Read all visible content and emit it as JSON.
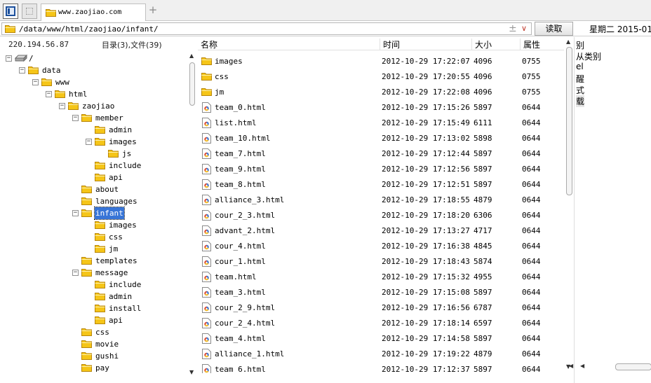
{
  "tabbar": {
    "tab_title": "www.zaojiao.com",
    "add_tab_symbol": "+"
  },
  "address": {
    "path": "/data/www/html/zaojiao/infant/",
    "add_symbol": "±",
    "dropdown_symbol": "∨",
    "read_button": "读取",
    "date": "星期二 2015-01-"
  },
  "tree_panel": {
    "host": "220.194.56.87",
    "summary": "目录(3),文件(39)",
    "nodes": [
      {
        "label": "/",
        "exp": "−",
        "icon": "drive-icon"
      },
      {
        "label": "data",
        "exp": "−",
        "icon": "folder-icon"
      },
      {
        "label": "www",
        "exp": "−",
        "icon": "folder-icon"
      },
      {
        "label": "html",
        "exp": "−",
        "icon": "folder-icon"
      },
      {
        "label": "zaojiao",
        "exp": "−",
        "icon": "folder-icon"
      },
      {
        "label": "member",
        "exp": "−",
        "icon": "folder-icon"
      },
      {
        "label": "admin",
        "exp": "",
        "icon": "folder-icon"
      },
      {
        "label": "images",
        "exp": "−",
        "icon": "folder-icon"
      },
      {
        "label": "js",
        "exp": "",
        "icon": "folder-icon"
      },
      {
        "label": "include",
        "exp": "",
        "icon": "folder-icon"
      },
      {
        "label": "api",
        "exp": "",
        "icon": "folder-icon"
      },
      {
        "label": "about",
        "exp": "",
        "icon": "folder-icon"
      },
      {
        "label": "languages",
        "exp": "",
        "icon": "folder-icon"
      },
      {
        "label": "infant",
        "exp": "−",
        "icon": "folder-icon",
        "selected": true
      },
      {
        "label": "images",
        "exp": "",
        "icon": "folder-icon"
      },
      {
        "label": "css",
        "exp": "",
        "icon": "folder-icon"
      },
      {
        "label": "jm",
        "exp": "",
        "icon": "folder-icon"
      },
      {
        "label": "templates",
        "exp": "",
        "icon": "folder-icon"
      },
      {
        "label": "message",
        "exp": "−",
        "icon": "folder-icon"
      },
      {
        "label": "include",
        "exp": "",
        "icon": "folder-icon"
      },
      {
        "label": "admin",
        "exp": "",
        "icon": "folder-icon"
      },
      {
        "label": "install",
        "exp": "",
        "icon": "folder-icon"
      },
      {
        "label": "api",
        "exp": "",
        "icon": "folder-icon"
      },
      {
        "label": "css",
        "exp": "",
        "icon": "folder-icon"
      },
      {
        "label": "movie",
        "exp": "",
        "icon": "folder-icon"
      },
      {
        "label": "gushi",
        "exp": "",
        "icon": "folder-icon"
      },
      {
        "label": "pay",
        "exp": "",
        "icon": "folder-icon"
      }
    ]
  },
  "file_list": {
    "columns": {
      "name": "名称",
      "time": "时间",
      "size": "大小",
      "perm": "属性"
    },
    "rows": [
      {
        "name": "images",
        "time": "2012-10-29 17:22:07",
        "size": "4096",
        "perm": "0755",
        "icon": "folder-icon"
      },
      {
        "name": "css",
        "time": "2012-10-29 17:20:55",
        "size": "4096",
        "perm": "0755",
        "icon": "folder-icon"
      },
      {
        "name": "jm",
        "time": "2012-10-29 17:22:08",
        "size": "4096",
        "perm": "0755",
        "icon": "folder-icon"
      },
      {
        "name": "team_0.html",
        "time": "2012-10-29 17:15:26",
        "size": "5897",
        "perm": "0644",
        "icon": "html-file-icon"
      },
      {
        "name": "list.html",
        "time": "2012-10-29 17:15:49",
        "size": "6111",
        "perm": "0644",
        "icon": "html-file-icon"
      },
      {
        "name": "team_10.html",
        "time": "2012-10-29 17:13:02",
        "size": "5898",
        "perm": "0644",
        "icon": "html-file-icon"
      },
      {
        "name": "team_7.html",
        "time": "2012-10-29 17:12:44",
        "size": "5897",
        "perm": "0644",
        "icon": "html-file-icon"
      },
      {
        "name": "team_9.html",
        "time": "2012-10-29 17:12:56",
        "size": "5897",
        "perm": "0644",
        "icon": "html-file-icon"
      },
      {
        "name": "team_8.html",
        "time": "2012-10-29 17:12:51",
        "size": "5897",
        "perm": "0644",
        "icon": "html-file-icon"
      },
      {
        "name": "alliance_3.html",
        "time": "2012-10-29 17:18:55",
        "size": "4879",
        "perm": "0644",
        "icon": "html-file-icon"
      },
      {
        "name": "cour_2_3.html",
        "time": "2012-10-29 17:18:20",
        "size": "6306",
        "perm": "0644",
        "icon": "html-file-icon"
      },
      {
        "name": "advant_2.html",
        "time": "2012-10-29 17:13:27",
        "size": "4717",
        "perm": "0644",
        "icon": "html-file-icon"
      },
      {
        "name": "cour_4.html",
        "time": "2012-10-29 17:16:38",
        "size": "4845",
        "perm": "0644",
        "icon": "html-file-icon"
      },
      {
        "name": "cour_1.html",
        "time": "2012-10-29 17:18:43",
        "size": "5874",
        "perm": "0644",
        "icon": "html-file-icon"
      },
      {
        "name": "team.html",
        "time": "2012-10-29 17:15:32",
        "size": "4955",
        "perm": "0644",
        "icon": "html-file-icon"
      },
      {
        "name": "team_3.html",
        "time": "2012-10-29 17:15:08",
        "size": "5897",
        "perm": "0644",
        "icon": "html-file-icon"
      },
      {
        "name": "cour_2_9.html",
        "time": "2012-10-29 17:16:56",
        "size": "6787",
        "perm": "0644",
        "icon": "html-file-icon"
      },
      {
        "name": "cour_2_4.html",
        "time": "2012-10-29 17:18:14",
        "size": "6597",
        "perm": "0644",
        "icon": "html-file-icon"
      },
      {
        "name": "team_4.html",
        "time": "2012-10-29 17:14:58",
        "size": "5897",
        "perm": "0644",
        "icon": "html-file-icon"
      },
      {
        "name": "alliance_1.html",
        "time": "2012-10-29 17:19:22",
        "size": "4879",
        "perm": "0644",
        "icon": "html-file-icon"
      },
      {
        "name": "team_6.html",
        "time": "2012-10-29 17:12:37",
        "size": "5897",
        "perm": "0644",
        "icon": "html-file-icon"
      }
    ]
  },
  "side_panel": {
    "items": [
      "别",
      "从类别",
      "el",
      "醒",
      "式",
      "载"
    ],
    "highlighted_index": 5
  },
  "colors": {
    "selection": "#3875d7",
    "folder": "#f5c518",
    "header_border": "#e2e2e2"
  }
}
